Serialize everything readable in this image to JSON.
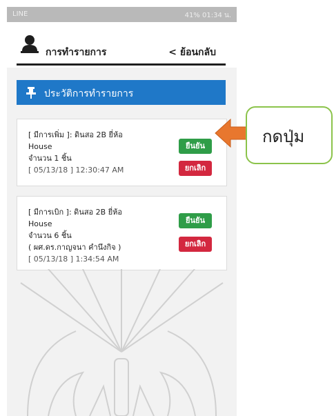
{
  "status_bar": {
    "carrier": "LINE",
    "right": "41% 01:34 น."
  },
  "header": {
    "title": "การทำรายการ",
    "back_label": "< ย้อนกลับ"
  },
  "panel": {
    "title": "ประวัติการทำรายการ"
  },
  "items": [
    {
      "line1": "[ มีการเพิ่ม ]: ดินสอ 2B  ยี่ห้อ",
      "line2": "House",
      "line3": "จำนวน 1  ชิ้น",
      "line4": "[ 05/13/18 ] 12:30:47 AM",
      "confirm_label": "ยืนยัน",
      "cancel_label": "ยกเลิก"
    },
    {
      "line1": "[ มีการเบิก ]: ดินสอ 2B  ยี่ห้อ",
      "line2": "House",
      "line3": "จำนวน 6  ชิ้น",
      "line4": "( ผศ.ดร.กาญจนา คำนึงกิจ )",
      "line5": "[ 05/13/18 ] 1:34:54 AM",
      "confirm_label": "ยืนยัน",
      "cancel_label": "ยกเลิก"
    }
  ],
  "annotation": {
    "label": "กดปุ่ม"
  },
  "colors": {
    "panel_blue": "#1f78c8",
    "confirm_green": "#2f9d48",
    "cancel_red": "#d3283f",
    "arrow_orange": "#e8772e",
    "callout_border": "#8bc34a"
  }
}
